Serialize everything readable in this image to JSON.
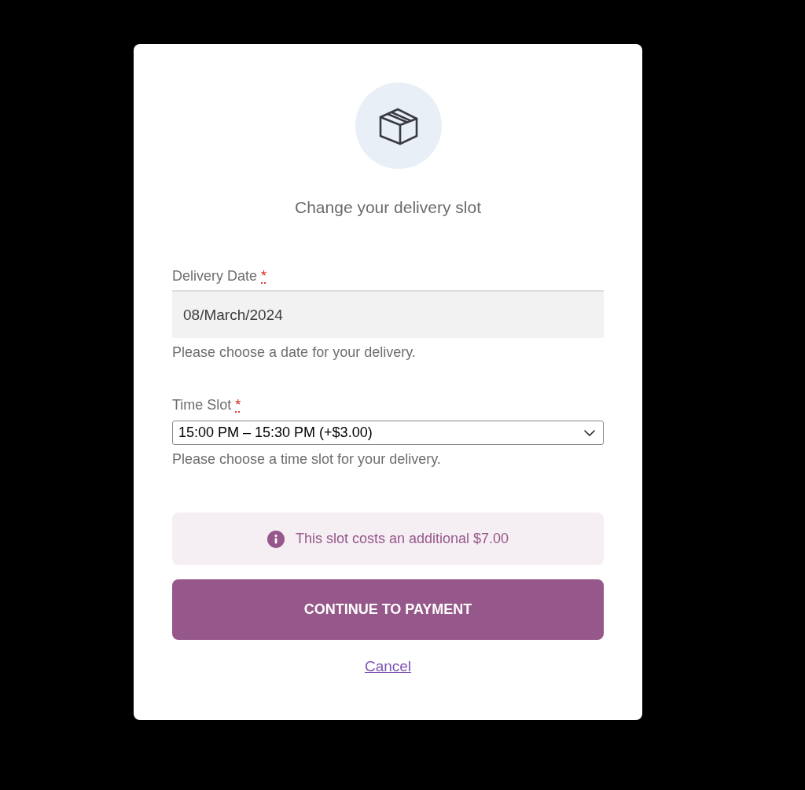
{
  "dialog": {
    "title": "Change your delivery slot",
    "fields": [
      {
        "kind": "date",
        "label": "Delivery Date",
        "required_mark": "*",
        "value": "08/March/2024",
        "hint": "Please choose a date for your delivery."
      },
      {
        "kind": "select",
        "label": "Time Slot",
        "required_mark": "*",
        "value": "15:00 PM – 15:30 PM (+$3.00)",
        "hint": "Please choose a time slot for your delivery."
      }
    ],
    "notice": {
      "text": "This slot costs an additional $7.00"
    },
    "primary_button": {
      "label": "CONTINUE TO PAYMENT"
    },
    "cancel_link": {
      "label": "Cancel"
    }
  }
}
